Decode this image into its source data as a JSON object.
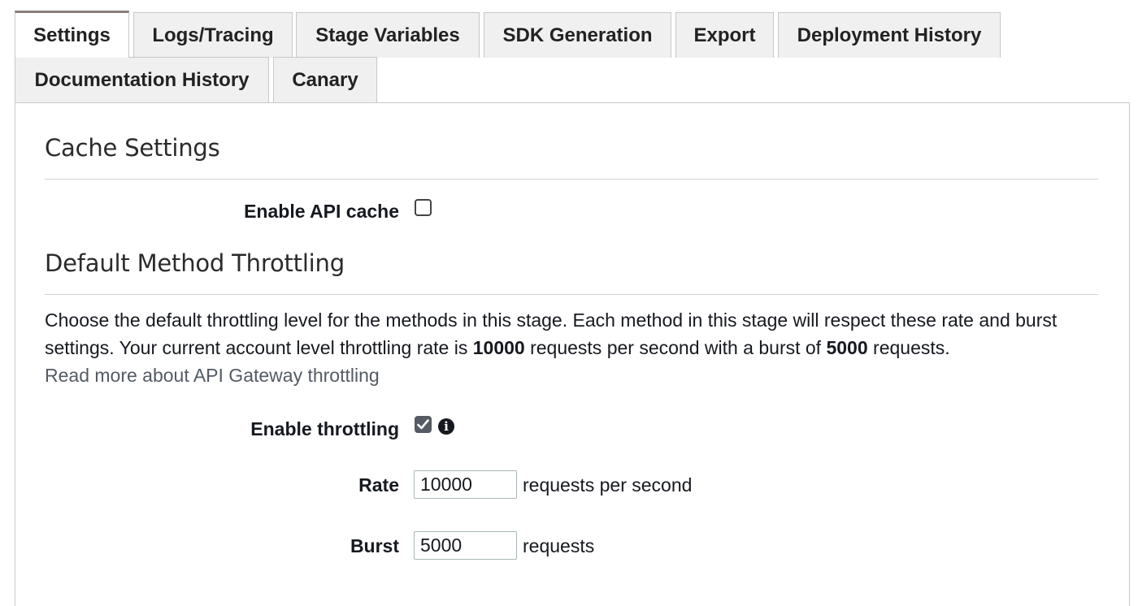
{
  "tabs": [
    {
      "label": "Settings",
      "active": true
    },
    {
      "label": "Logs/Tracing",
      "active": false
    },
    {
      "label": "Stage Variables",
      "active": false
    },
    {
      "label": "SDK Generation",
      "active": false
    },
    {
      "label": "Export",
      "active": false
    },
    {
      "label": "Deployment History",
      "active": false
    },
    {
      "label": "Documentation History",
      "active": false
    },
    {
      "label": "Canary",
      "active": false
    }
  ],
  "cache_settings": {
    "title": "Cache Settings",
    "enable_api_cache_label": "Enable API cache",
    "enable_api_cache_checked": false
  },
  "throttling": {
    "title": "Default Method Throttling",
    "description_part1": "Choose the default throttling level for the methods in this stage. Each method in this stage will respect these rate and burst settings. Your current account level throttling rate is ",
    "account_rate": "10000",
    "description_part2": " requests per second with a burst of ",
    "account_burst": "5000",
    "description_part3": " requests.",
    "read_more_link": "Read more about API Gateway throttling",
    "enable_throttling_label": "Enable throttling",
    "enable_throttling_checked": true,
    "info_icon": "info-circle-icon",
    "rate_label": "Rate",
    "rate_value": "10000",
    "rate_unit": "requests per second",
    "burst_label": "Burst",
    "burst_value": "5000",
    "burst_unit": "requests"
  },
  "colors": {
    "active_tab_accent": "#8a7d7a",
    "checkbox_checked": "#545b64",
    "link": "#545b64"
  }
}
